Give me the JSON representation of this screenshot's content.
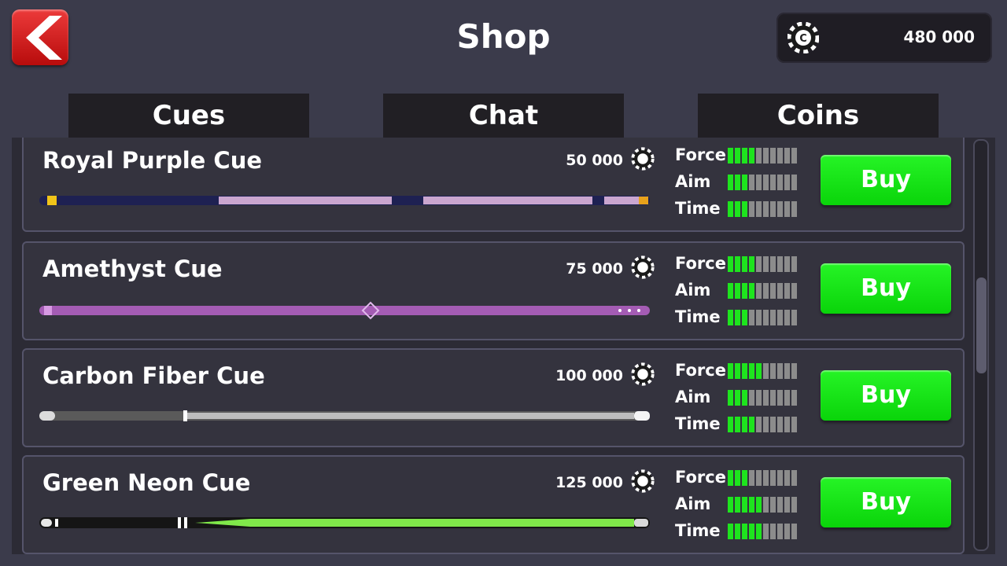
{
  "header": {
    "title": "Shop",
    "coins": "480 000",
    "back_icon": "back-arrow-icon",
    "coin_icon": "chip-coin-icon"
  },
  "tabs": [
    {
      "label": "Cues",
      "active": true
    },
    {
      "label": "Chat",
      "active": false
    },
    {
      "label": "Coins",
      "active": false
    }
  ],
  "stat_labels": {
    "force": "Force",
    "aim": "Aim",
    "time": "Time"
  },
  "buy_label": "Buy",
  "items": [
    {
      "name": "Royal Purple Cue",
      "price": "50 000",
      "force": 4,
      "aim": 3,
      "time": 3
    },
    {
      "name": "Amethyst Cue",
      "price": "75 000",
      "force": 4,
      "aim": 4,
      "time": 3
    },
    {
      "name": "Carbon Fiber Cue",
      "price": "100 000",
      "force": 5,
      "aim": 3,
      "time": 4
    },
    {
      "name": "Green Neon Cue",
      "price": "125 000",
      "force": 3,
      "aim": 5,
      "time": 5
    }
  ],
  "max_stat": 10,
  "colors": {
    "accent_green": "#1ee41e",
    "back_red": "#d32020",
    "background": "#3b3b4b"
  }
}
